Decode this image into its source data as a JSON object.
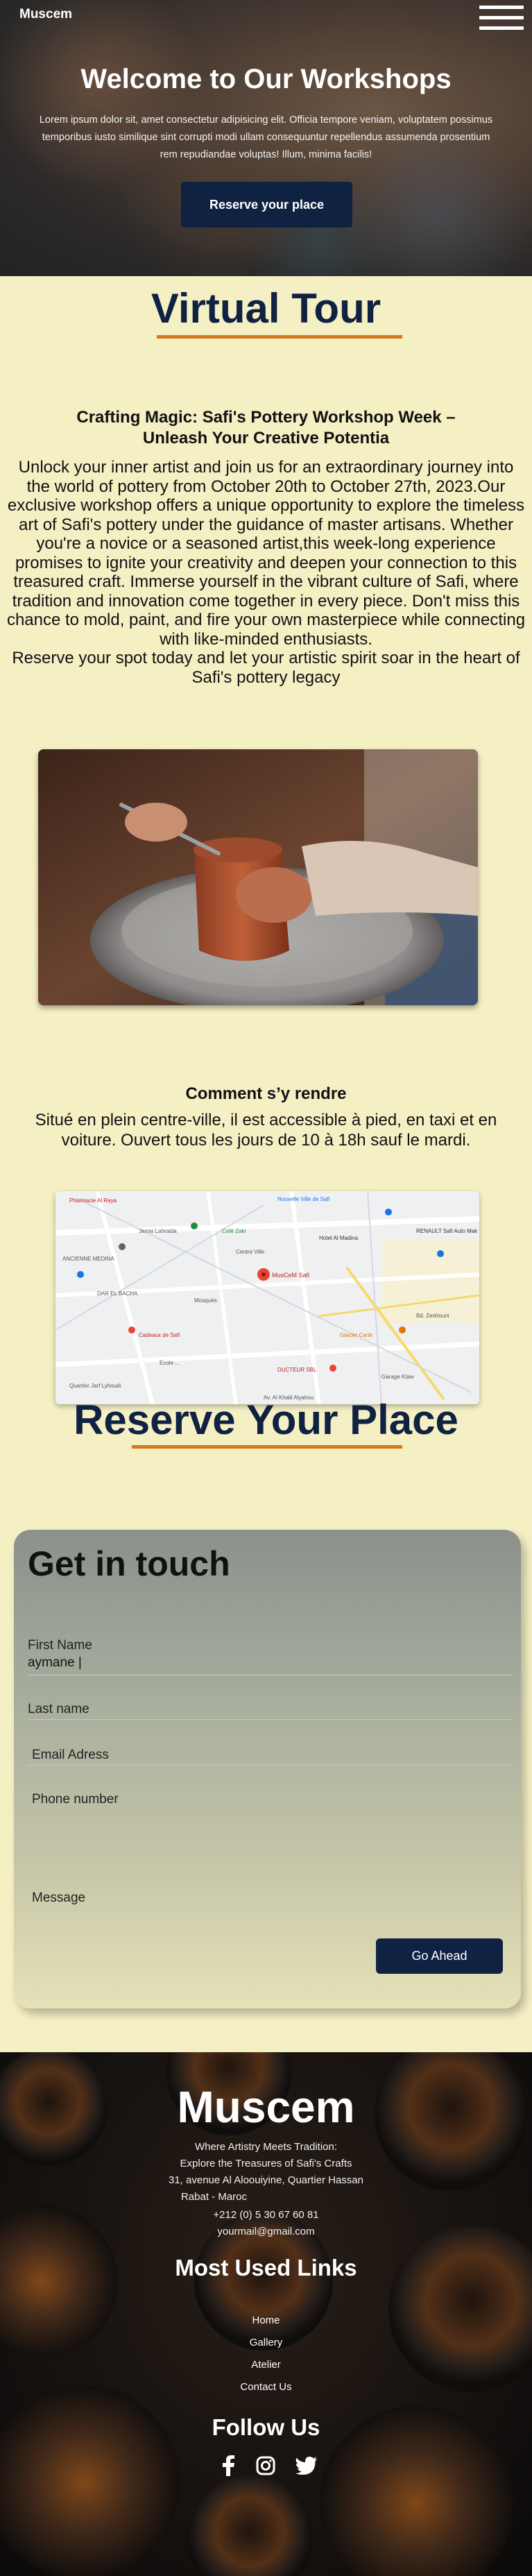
{
  "header": {
    "brand": "Muscem",
    "menu_icon": "hamburger-menu-icon"
  },
  "hero": {
    "title": "Welcome to Our Workshops",
    "text": "Lorem ipsum dolor sit, amet consectetur adipisicing elit. Officia tempore veniam, voluptatem possimus temporibus iusto similique sint corrupti modi ullam consequuntur repellendus assumenda prosentium rem repudiandae voluptas! Illum, minima facilis!",
    "button": "Reserve your place"
  },
  "virtual_tour": {
    "title": "Virtual Tour",
    "workshop_title": "Crafting Magic: Safi's Pottery Workshop Week – Unleash Your Creative Potentia",
    "workshop_body": "Unlock your inner artist and join us for an extraordinary journey into the world of pottery from October 20th to October 27th, 2023.Our exclusive workshop offers a unique opportunity to explore the timeless art of Safi's pottery under the guidance of master artisans. Whether you're a novice or a seasoned artist,this week-long experience promises to ignite your creativity and deepen your connection to this treasured craft. Immerse yourself in the vibrant culture of Safi, where tradition and innovation come together in every piece. Don't miss this chance to mold, paint, and fire your own masterpiece while connecting with like-minded enthusiasts.",
    "workshop_cta": "Reserve your spot today and let your artistic spirit soar in the heart of Safi's pottery legacy"
  },
  "howto": {
    "title": "Comment s’y rendre",
    "text": "Situé en plein centre-ville, il est accessible à pied, en taxi et en voiture. Ouvert tous les jours de 10 à 18h sauf le mardi."
  },
  "map": {
    "labels": {
      "pin": "MusCeM Safi",
      "pharmacie": "Pharmacie Al Raya",
      "ville": "Nouvelle Ville de Safi",
      "renault": "RENAULT Safi Auto Mak",
      "hotel": "Hotel Al Madina",
      "cafe": "Café Zaki",
      "centre": "Centre Ville",
      "jamia": "Jamia Lahraida",
      "ancienne": "ANCIENNE MEDINA",
      "dafali": "DAR EL BACHA",
      "cadeaux": "Cadeaux de Safi",
      "zalgh": "DUCTEUR SBL",
      "glacier": "Glacier Carte",
      "quartier": "Quartier Jarf Lyhoudi",
      "boulevard": "Bd. Zerktouni",
      "avenue": "Av. Al Khalil Alyahou",
      "garage": "Garage Ktaw",
      "ecole": "Ecole ...",
      "mosque": "Mosquée"
    }
  },
  "reserve": {
    "title": "Reserve Your Place"
  },
  "form": {
    "heading": "Get in touch",
    "first_name_label": "First Name",
    "first_name_value": "aymane |",
    "last_name_label": "Last name",
    "email_label": "Email Adress",
    "phone_label": "Phone number",
    "message_label": "Message",
    "submit": "Go Ahead"
  },
  "footer": {
    "brand": "Muscem",
    "tagline": "Where Artistry Meets Tradition:",
    "tagline2": "Explore the Treasures of Safi's Crafts",
    "address1": "31, avenue Al Aloouiyine, Quartier Hassan",
    "address2": "Rabat - Maroc",
    "phone": "+212 (0) 5 30 67 60 81",
    "email": "yourmail@gmail.com",
    "links_title": "Most Used Links",
    "links": [
      "Home",
      "Gallery",
      "Atelier",
      "Contact Us"
    ],
    "follow_title": "Follow Us",
    "social_icons": [
      "facebook-icon",
      "instagram-icon",
      "twitter-icon"
    ]
  },
  "colors": {
    "page_bg": "#f5efc4",
    "navy": "#0f2242",
    "accent": "#d4781e"
  }
}
